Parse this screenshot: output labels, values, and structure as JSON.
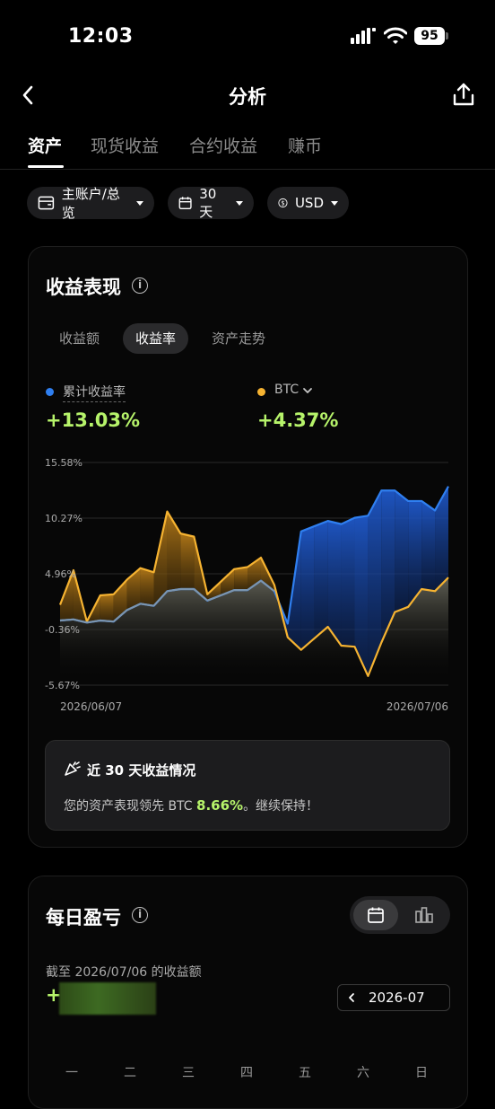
{
  "status_bar": {
    "time": "12:03",
    "battery": "95"
  },
  "header": {
    "title": "分析"
  },
  "tabs": [
    "资产",
    "现货收益",
    "合约收益",
    "赚币"
  ],
  "filters": {
    "account": "主账户/总览",
    "period": "30 天",
    "currency": "USD"
  },
  "performance": {
    "title": "收益表现",
    "subtabs": [
      "收益额",
      "收益率",
      "资产走势"
    ],
    "active_subtab": "收益率",
    "legend": [
      {
        "label": "累计收益率",
        "value": "+13.03%",
        "color": "#2f7ff0"
      },
      {
        "label": "BTC",
        "value": "+4.37%",
        "color": "#f6b331"
      }
    ]
  },
  "chart_data": {
    "type": "area",
    "title": "",
    "y_tick_labels": [
      "15.58%",
      "10.27%",
      "4.96%",
      "-0.36%",
      "-5.67%"
    ],
    "y_ticks": [
      15.58,
      10.27,
      4.96,
      -0.36,
      -5.67
    ],
    "ylim": [
      -5.67,
      15.58
    ],
    "x_start_label": "2026/06/07",
    "x_end_label": "2026/07/06",
    "grid": true,
    "series": [
      {
        "name": "累计收益率",
        "color": "#2f7ff0",
        "values": [
          0.5,
          0.6,
          0.3,
          0.5,
          0.4,
          1.5,
          2.1,
          1.9,
          3.3,
          3.5,
          3.5,
          2.4,
          2.9,
          3.4,
          3.4,
          4.3,
          3.3,
          0.2,
          9.0,
          9.5,
          10.0,
          9.7,
          10.3,
          10.5,
          12.9,
          12.9,
          11.9,
          11.9,
          11.0,
          13.3
        ]
      },
      {
        "name": "BTC",
        "color": "#f6b331",
        "values": [
          2.0,
          5.3,
          0.4,
          2.9,
          3.0,
          4.4,
          5.5,
          5.1,
          10.9,
          8.8,
          8.5,
          3.0,
          4.2,
          5.4,
          5.6,
          6.5,
          3.9,
          -1.1,
          -2.3,
          -1.2,
          -0.1,
          -1.9,
          -2.0,
          -4.8,
          -1.6,
          1.3,
          1.8,
          3.5,
          3.3,
          4.6
        ]
      }
    ]
  },
  "summary": {
    "title": "近 30 天收益情况",
    "text_before": "您的资产表现领先 BTC ",
    "highlight": "8.66%",
    "text_after": "。继续保持！"
  },
  "daily": {
    "title": "每日盈亏",
    "as_of": "截至 2026/07/06 的收益额",
    "amount_prefix": "+$",
    "month": "2026-07",
    "weekdays": [
      "一",
      "二",
      "三",
      "四",
      "五",
      "六",
      "日"
    ]
  }
}
